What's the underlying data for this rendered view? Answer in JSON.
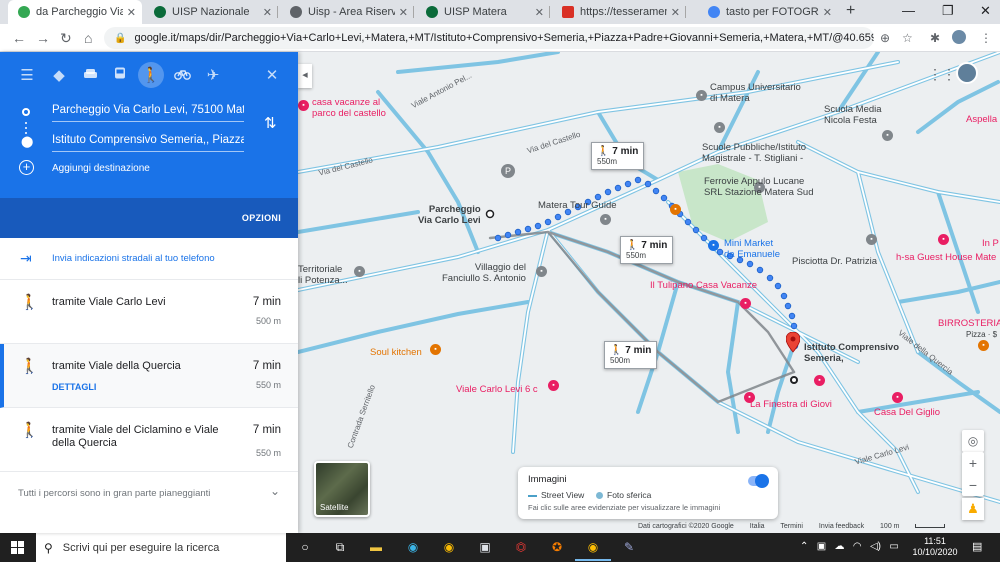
{
  "browser": {
    "tabs": [
      {
        "title": "da Parcheggio Via Carlo L",
        "color": "#34a853",
        "active": true
      },
      {
        "title": "UISP Nazionale",
        "color": "#0b6b3a",
        "active": false
      },
      {
        "title": "Uisp - Area Riservata 2.0",
        "color": "#5f6368",
        "active": false
      },
      {
        "title": "UISP Matera",
        "color": "#0b6b3a",
        "active": false
      },
      {
        "title": "https://tesseramento.uisp",
        "color": "#d93025",
        "active": false
      },
      {
        "title": "tasto per FOTOGRAFARE",
        "color": "#4285f4",
        "active": false
      }
    ],
    "url": "google.it/maps/dir/Parcheggio+Via+Carlo+Levi,+Matera,+MT/Istituto+Comprensivo+Semeria,+Piazza+Padre+Giovanni+Semeria,+Matera,+MT/@40.6596459,16..."
  },
  "sidebar": {
    "origin": "Parcheggio Via Carlo Levi, 75100 Matera",
    "destination": "Istituto Comprensivo Semeria,, Piazza Padre",
    "add_destination": "Aggiungi destinazione",
    "options": "OPZIONI",
    "send_to_phone": "Invia indicazioni stradali al tuo telefono",
    "routes": [
      {
        "name": "tramite Viale Carlo Levi",
        "duration": "7 min",
        "distance": "500 m",
        "details": ""
      },
      {
        "name": "tramite Viale della Quercia",
        "duration": "7 min",
        "distance": "550 m",
        "details": "DETTAGLI"
      },
      {
        "name": "tramite Viale del Ciclamino e Viale della Quercia",
        "duration": "7 min",
        "distance": "550 m",
        "details": ""
      }
    ],
    "flat_note": "Tutti i percorsi sono in gran parte pianeggianti"
  },
  "map": {
    "labels": {
      "casa_vacanze": "casa vacanze al\nparco del castello",
      "campus": "Campus Universitario\ndi Matera",
      "scuola_media": "Scuola Media\nNicola Festa",
      "aspella": "Aspella",
      "scuole_pubbliche": "Scuole Pubbliche/Istituto\nMagistrale - T. Stigliani -",
      "ferrovie": "Ferrovie Appulo Lucane\nSRL Stazione Matera Sud",
      "parcheggio": "Parcheggio\nVia Carlo Levi",
      "matera_tour": "Matera Tour Guide",
      "mini_market": "Mini Market\nda Emanuele",
      "pisciotta": "Pisciotta Dr. Patrizia",
      "hsa": "h-sa Guest House Mate",
      "in_p": "In P",
      "territoriale": "Territoriale\nli Potenza...",
      "villaggio": "Villaggio del\nFanciullo S. Antonio",
      "tulipano": "Il Tulipano Casa Vacanze",
      "birrosteria": "BIRROSTERIA",
      "pizza": "Pizza · $",
      "istituto": "Istituto Comprensivo\nSemeria,",
      "soul_kitchen": "Soul kitchen",
      "viale_carlo_levi_6c": "Viale Carlo Levi 6 c",
      "finestra": "La Finestra di Giovi",
      "casa_giglio": "Casa Del Giglio"
    },
    "roads": {
      "castello": "Via del Castello",
      "castello2": "Via del Castello",
      "zanardelli": "Viale Antonio Pel...",
      "vergara": "Contrada Serritello",
      "carlo_levi": "Viale Carlo Levi",
      "della_quercia": "Viale della Quercia"
    },
    "bubbles": [
      {
        "time": "7 min",
        "dist": "550m"
      },
      {
        "time": "7 min",
        "dist": "550m"
      },
      {
        "time": "7 min",
        "dist": "500m"
      }
    ],
    "satellite_label": "Satellite",
    "imagery": {
      "title": "Immagini",
      "street_view": "Street View",
      "photo_sphere": "Foto sferica",
      "hint": "Fai clic sulle aree evidenziate per visualizzare le immagini"
    },
    "footer": {
      "data": "Dati cartografici ©2020 Google",
      "italy": "Italia",
      "terms": "Termini",
      "feedback": "Invia feedback",
      "scale": "100 m"
    }
  },
  "taskbar": {
    "search_placeholder": "Scrivi qui per eseguire la ricerca",
    "time": "11:51",
    "date": "10/10/2020"
  }
}
